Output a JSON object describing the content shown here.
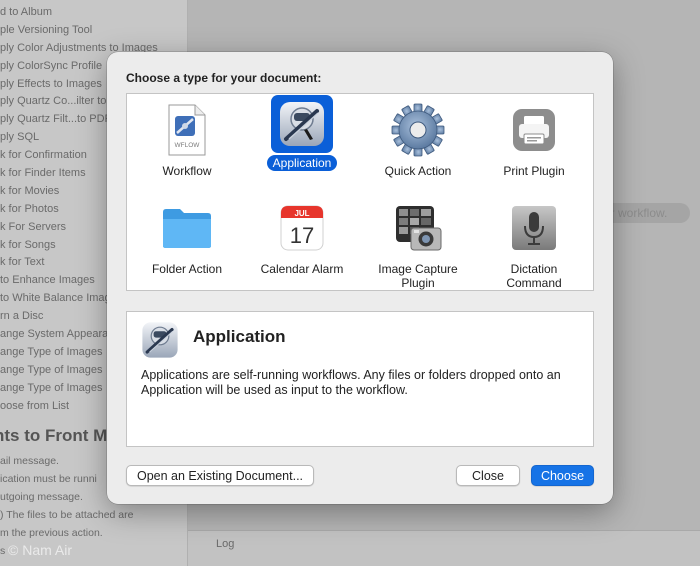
{
  "background": {
    "list_items": [
      "d to Album",
      "ple Versioning Tool",
      "ply Color Adjustments to Images",
      "ply ColorSync Profile",
      "ply Effects to Images",
      "ply Quartz Co...ilter to",
      "ply Quartz Filt...to PDF",
      "ply SQL",
      "k for Confirmation",
      "k for Finder Items",
      "k for Movies",
      "k for Photos",
      "k For Servers",
      "k for Songs",
      "k for Text",
      "to Enhance Images",
      "to White Balance Imag",
      "rn a Disc",
      "ange System Appeara",
      "ange Type of Images",
      "ange Type of Images",
      "ange Type of Images",
      "oose from List"
    ],
    "detail_title": "nts to Front M",
    "detail_lines": [
      "ail message.",
      "ication must be runni",
      "utgoing message.",
      ") The files to be attached are",
      "m the previous action.",
      "s"
    ],
    "workflow_hint": "ur workflow.",
    "log_label": "Log",
    "watermark": "© Nam Air"
  },
  "dialog": {
    "prompt": "Choose a type for your document:",
    "types": [
      {
        "label": "Workflow",
        "icon": "workflow-document-icon",
        "icon_text": "WFLOW",
        "selected": false
      },
      {
        "label": "Application",
        "icon": "automator-robot-icon",
        "selected": true
      },
      {
        "label": "Quick Action",
        "icon": "gear-icon",
        "selected": false
      },
      {
        "label": "Print Plugin",
        "icon": "printer-icon",
        "selected": false
      },
      {
        "label": "Folder Action",
        "icon": "folder-icon",
        "selected": false
      },
      {
        "label": "Calendar Alarm",
        "icon": "calendar-icon",
        "month": "JUL",
        "day": "17",
        "selected": false
      },
      {
        "label": "Image Capture Plugin",
        "icon": "image-capture-icon",
        "selected": false
      },
      {
        "label": "Dictation Command",
        "icon": "microphone-icon",
        "selected": false
      }
    ],
    "description": {
      "title": "Application",
      "text": "Applications are self-running workflows. Any files or folders dropped onto an Application will be used as input to the workflow."
    },
    "buttons": {
      "open_existing": "Open an Existing Document...",
      "close": "Close",
      "choose": "Choose"
    },
    "colors": {
      "accent": "#0a5fd8",
      "choose_button": "#1673e6"
    }
  }
}
